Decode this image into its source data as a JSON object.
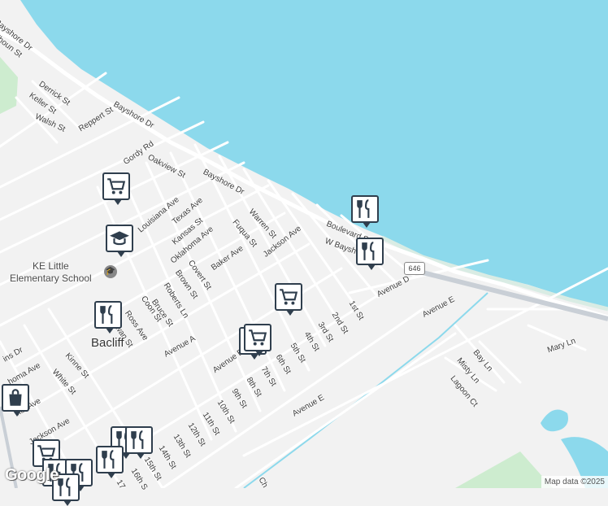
{
  "map": {
    "colors": {
      "water": "#8cd9ec",
      "land": "#f2f2f2",
      "road": "#ffffff",
      "park": "#cdeccf",
      "highway": "#c9cfd6"
    },
    "town_label": "Bacliff",
    "school_label": "KE Little\nElementary School",
    "route_shield": "646",
    "logo": "Google",
    "attribution": "Map data ©2025",
    "street_labels": [
      "Bayshore Dr",
      "lhoun St",
      "Derrick St",
      "Keller St",
      "Walsh St",
      "Reppert St",
      "Bayshore Dr",
      "Gordy Rd",
      "Oakview St",
      "Bayshore Dr",
      "Louisiana Ave",
      "Texas Ave",
      "Kansas St",
      "Warren St",
      "Fuqua St",
      "Jackson Ave",
      "Boulevard St",
      "W Bayshore",
      "Oklahoma Ave",
      "Baker Ave",
      "Covert St",
      "Brown St",
      "Roberts Ln",
      "Coon St",
      "Bruce St",
      "Ross Ave",
      "wan St",
      "Avenue D",
      "Avenue E",
      "1st St",
      "2nd St",
      "3rd St",
      "4th St",
      "5th St",
      "6th St",
      "7th St",
      "8th St",
      "9th St",
      "10th St",
      "11th St",
      "12th St",
      "13th St",
      "14th St",
      "15th St",
      "16th S",
      "17",
      "Avenue E",
      "Avenue A",
      "Avenue B",
      "ins Dr",
      "homa Ave",
      "Kinne St",
      "White St",
      "ker Ave",
      "Jackson Ave",
      "Bay Ln",
      "Misty Ln",
      "Lagoon Ct",
      "Mary Ln",
      "Ch"
    ],
    "markers": [
      {
        "type": "restaurant"
      },
      {
        "type": "restaurant"
      },
      {
        "type": "grocery"
      },
      {
        "type": "grocery"
      },
      {
        "type": "grocery"
      },
      {
        "type": "school"
      },
      {
        "type": "restaurant"
      },
      {
        "type": "shopping"
      },
      {
        "type": "grocery"
      },
      {
        "type": "restaurant"
      },
      {
        "type": "restaurant"
      },
      {
        "type": "restaurant"
      },
      {
        "type": "grocery"
      },
      {
        "type": "restaurant"
      },
      {
        "type": "restaurant"
      },
      {
        "type": "restaurant"
      }
    ]
  }
}
